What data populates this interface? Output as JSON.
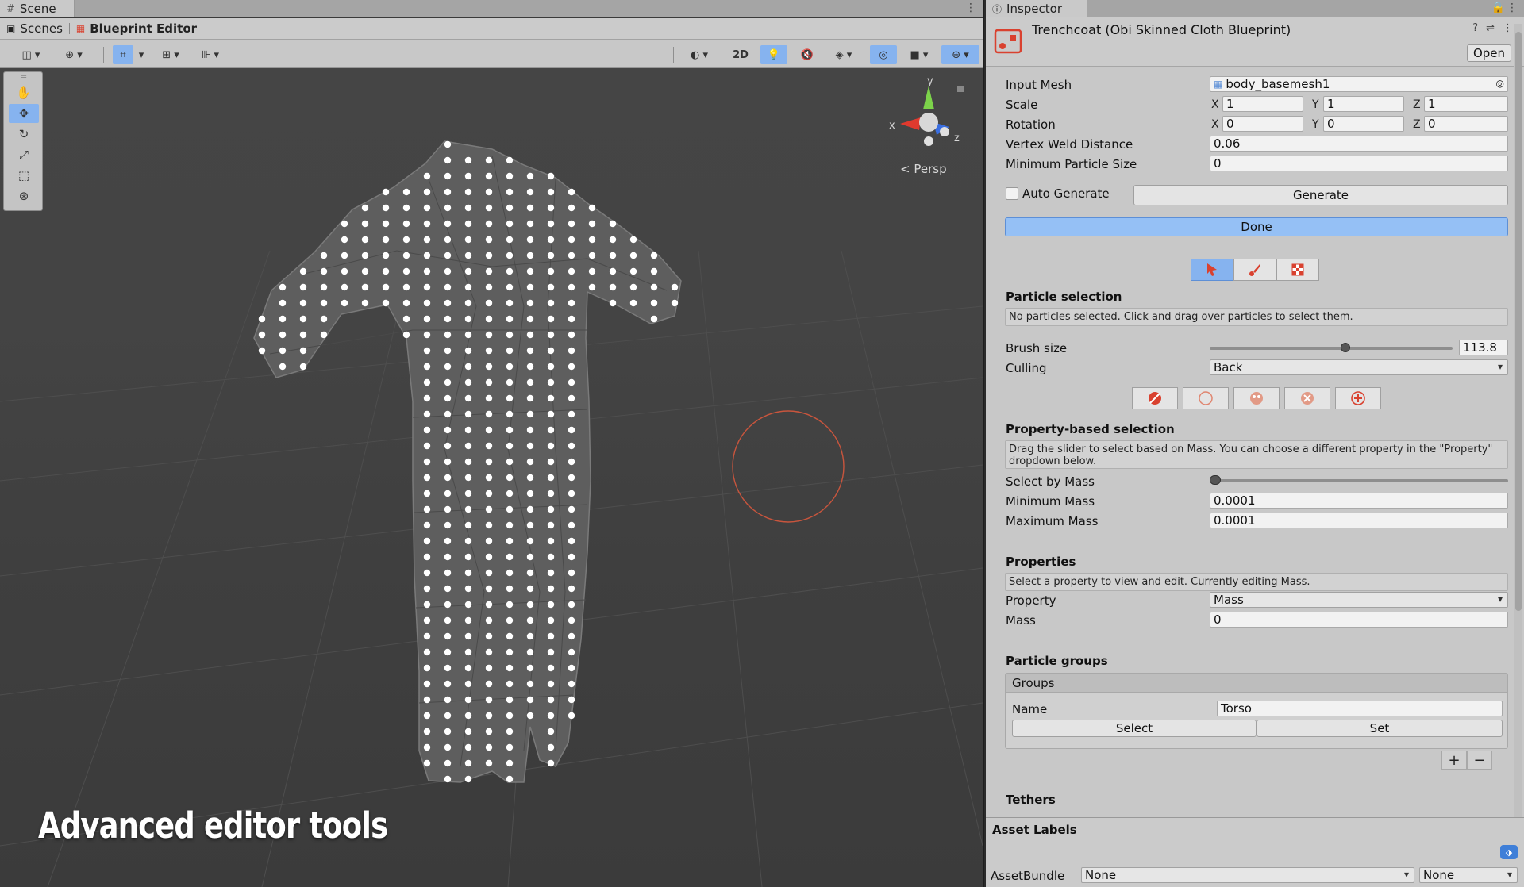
{
  "scene": {
    "tab_label": "Scene",
    "breadcrumb_root": "Scenes",
    "breadcrumb_current": "Blueprint Editor",
    "toolbar": {
      "mode_2d": "2D"
    },
    "projection_label": "Persp",
    "gizmo_axes": {
      "y": "y",
      "x": "x",
      "z": "z"
    },
    "headline": "Advanced editor tools"
  },
  "inspector": {
    "tab_label": "Inspector",
    "object_title": "Trenchcoat (Obi Skinned Cloth Blueprint)",
    "open_label": "Open",
    "fields": {
      "input_mesh_label": "Input Mesh",
      "input_mesh_value": "body_basemesh1",
      "scale_label": "Scale",
      "scale": {
        "x": "1",
        "y": "1",
        "z": "1"
      },
      "rotation_label": "Rotation",
      "rotation": {
        "x": "0",
        "y": "0",
        "z": "0"
      },
      "axis_x": "X",
      "axis_y": "Y",
      "axis_z": "Z",
      "vertex_weld_label": "Vertex Weld Distance",
      "vertex_weld_value": "0.06",
      "min_particle_label": "Minimum Particle Size",
      "min_particle_value": "0"
    },
    "auto_generate_label": "Auto Generate",
    "generate_label": "Generate",
    "done_label": "Done",
    "particle_selection": {
      "title": "Particle selection",
      "help": "No particles selected. Click and drag over particles to select them.",
      "brush_size_label": "Brush size",
      "brush_size_value": "113.8",
      "brush_size_fraction": 0.56,
      "culling_label": "Culling",
      "culling_value": "Back"
    },
    "property_selection": {
      "title": "Property-based selection",
      "help": "Drag the slider to select based on Mass. You can choose a different property in the \"Property\" dropdown below.",
      "select_by_label": "Select by Mass",
      "min_label": "Minimum Mass",
      "min_value": "0.0001",
      "max_label": "Maximum Mass",
      "max_value": "0.0001"
    },
    "properties": {
      "title": "Properties",
      "help": "Select a property to view and edit. Currently editing Mass.",
      "property_label": "Property",
      "property_value": "Mass",
      "mass_label": "Mass",
      "mass_value": "0"
    },
    "particle_groups": {
      "title": "Particle groups",
      "groups_header": "Groups",
      "name_label": "Name",
      "name_value": "Torso",
      "select_label": "Select",
      "set_label": "Set",
      "add": "+",
      "remove": "−"
    },
    "tethers_title": "Tethers",
    "asset_labels": {
      "title": "Asset Labels",
      "bundle_label": "AssetBundle",
      "bundle_value": "None",
      "variant_value": "None"
    },
    "colors": {
      "accent_blue": "#86b3ef",
      "done_blue": "#95c0f5",
      "brush_circle": "#c8553d",
      "brand_red": "#d9412f"
    }
  }
}
